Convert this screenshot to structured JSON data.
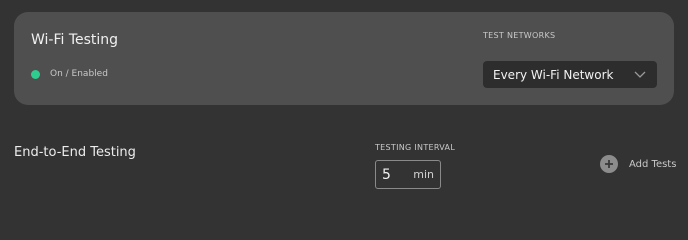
{
  "wifi_card": {
    "title": "Wi-Fi Testing",
    "status_text": "On / Enabled",
    "status_color": "#2ecc8f",
    "networks_label": "TEST NETWORKS",
    "networks_selected": "Every Wi-Fi Network",
    "networks_icon": "chevron-down-icon"
  },
  "e2e": {
    "title": "End-to-End Testing",
    "interval_label": "TESTING INTERVAL",
    "interval_value": "5",
    "interval_unit": "min",
    "add_label": "Add Tests",
    "add_icon": "plus-circle-icon"
  }
}
